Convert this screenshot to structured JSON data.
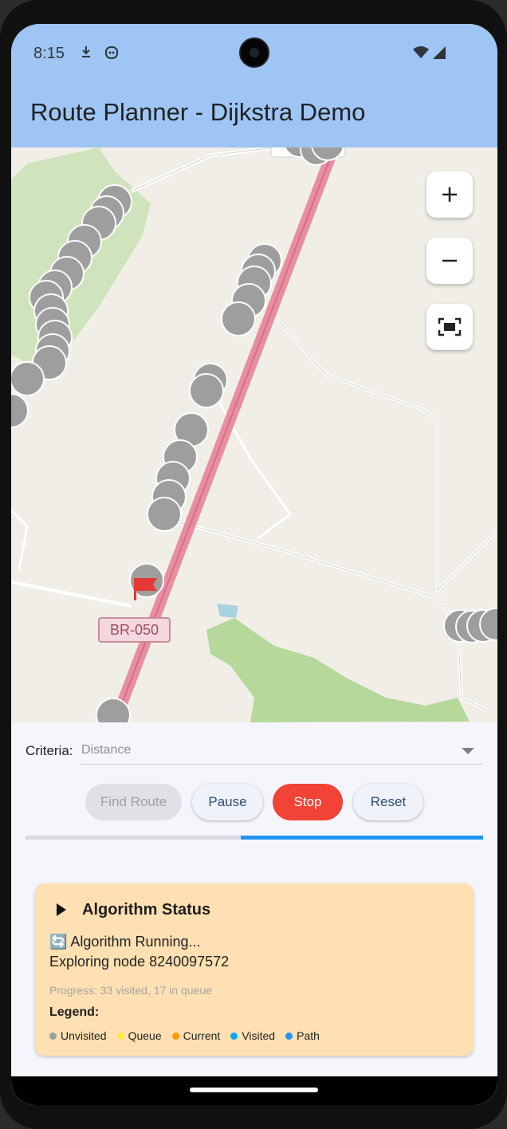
{
  "status_bar": {
    "time": "8:15"
  },
  "app_bar": {
    "title": "Route Planner - Dijkstra Demo"
  },
  "map": {
    "road_label": "BR-050",
    "controls": [
      "zoom-in",
      "zoom-out",
      "fit-bounds"
    ]
  },
  "criteria": {
    "label": "Criteria:",
    "value": "Distance"
  },
  "buttons": {
    "find": "Find Route",
    "pause": "Pause",
    "stop": "Stop",
    "reset": "Reset"
  },
  "progress": {
    "fraction": 0.53
  },
  "status_card": {
    "title": "Algorithm Status",
    "line1": "🔄 Algorithm Running...",
    "line2": "Exploring node 8240097572",
    "progress": "Progress: 33 visited, 17 in queue",
    "legend_title": "Legend:",
    "legend": [
      {
        "label": "Unvisited",
        "color": "#9e9e9e"
      },
      {
        "label": "Queue",
        "color": "#ffeb3b"
      },
      {
        "label": "Current",
        "color": "#ff9800"
      },
      {
        "label": "Visited",
        "color": "#03a9f4"
      },
      {
        "label": "Path",
        "color": "#2196f3"
      }
    ]
  },
  "colors": {
    "app_bar": "#9ec5f3",
    "stop": "#f14336",
    "progress": "#2196f3",
    "card": "#ffe0b2"
  }
}
